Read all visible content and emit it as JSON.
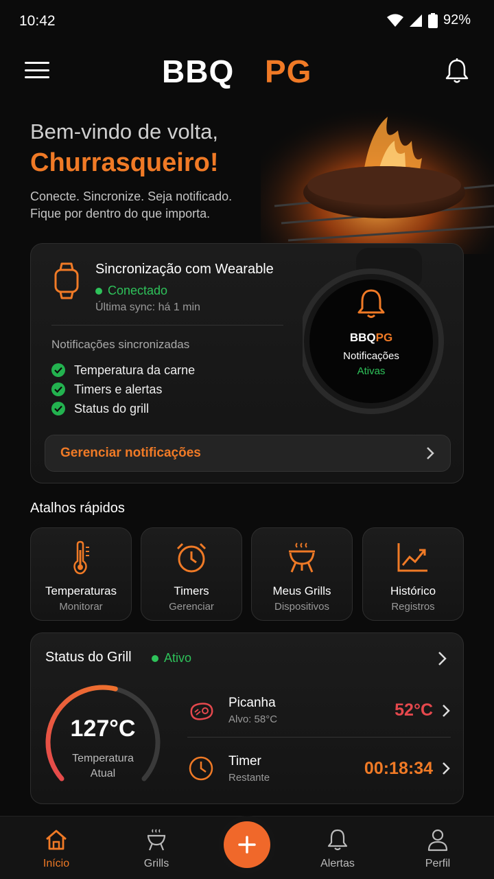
{
  "status_bar": {
    "time": "10:42",
    "battery": "92%"
  },
  "header": {
    "logo": "BBQPG"
  },
  "hero": {
    "greeting": "Bem-vindo de volta,",
    "name": "Churrasqueiro!",
    "subtitle_line1": "Conecte. Sincronize. Seja notificado.",
    "subtitle_line2": "Fique por dentro do que importa."
  },
  "wearable": {
    "title": "Sincronização com Wearable",
    "status": "Conectado",
    "last_sync": "Última sync: há 1 min",
    "notif_heading": "Notificações sincronizadas",
    "items": [
      "Temperatura da carne",
      "Timers e alertas",
      "Status do grill"
    ],
    "watch_screen": {
      "logo": "BBQPG",
      "line1": "Notificações",
      "line2": "Ativas"
    },
    "manage_label": "Gerenciar notificações"
  },
  "quick": {
    "title": "Atalhos rápidos",
    "items": [
      {
        "label": "Temperaturas",
        "sub": "Monitorar",
        "icon": "thermometer-icon"
      },
      {
        "label": "Timers",
        "sub": "Gerenciar",
        "icon": "alarm-clock-icon"
      },
      {
        "label": "Meus Grills",
        "sub": "Dispositivos",
        "icon": "grill-icon"
      },
      {
        "label": "Histórico",
        "sub": "Registros",
        "icon": "trend-chart-icon"
      }
    ]
  },
  "grill": {
    "title": "Status do Grill",
    "status": "Ativo",
    "temp": "127°C",
    "temp_label_1": "Temperatura",
    "temp_label_2": "Atual",
    "gauge_fraction": 0.55,
    "rows": [
      {
        "title": "Picanha",
        "sub": "Alvo: 58°C",
        "value": "52°C",
        "color": "#e5484d"
      },
      {
        "title": "Timer",
        "sub": "Restante",
        "value": "00:18:34",
        "color": "#f07a26"
      }
    ]
  },
  "nav": {
    "items": [
      {
        "label": "Início",
        "icon": "home-icon"
      },
      {
        "label": "Grills",
        "icon": "grill-icon"
      },
      {
        "label": "Alertas",
        "icon": "bell-icon"
      },
      {
        "label": "Perfil",
        "icon": "user-icon"
      }
    ]
  },
  "colors": {
    "accent": "#f07a26",
    "success": "#2ec25a",
    "danger": "#e5484d",
    "background": "#0b0b0b"
  }
}
